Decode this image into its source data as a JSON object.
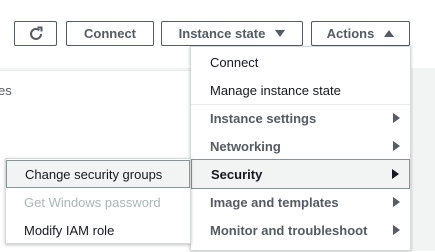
{
  "toolbar": {
    "refresh_icon": "refresh-icon",
    "connect_label": "Connect",
    "instance_state_label": "Instance state",
    "actions_label": "Actions"
  },
  "background": {
    "partial_text": "es"
  },
  "actions_menu": {
    "items": [
      {
        "label": "Connect",
        "style": "normal"
      },
      {
        "label": "Manage instance state",
        "style": "normal"
      },
      {
        "label": "Instance settings",
        "style": "bold",
        "submenu": true
      },
      {
        "label": "Networking",
        "style": "bold",
        "submenu": true
      },
      {
        "label": "Security",
        "style": "bold",
        "submenu": true,
        "active": true
      },
      {
        "label": "Image and templates",
        "style": "bold",
        "submenu": true
      },
      {
        "label": "Monitor and troubleshoot",
        "style": "bold",
        "submenu": true
      }
    ]
  },
  "security_submenu": {
    "items": [
      {
        "label": "Change security groups",
        "active": true
      },
      {
        "label": "Get Windows password",
        "disabled": true
      },
      {
        "label": "Modify IAM role"
      }
    ]
  },
  "colors": {
    "text": "#16191f",
    "muted": "#545b64",
    "disabled": "#aab7b8",
    "hover_bg": "#f2f3f3",
    "border": "#d5dbdb"
  }
}
